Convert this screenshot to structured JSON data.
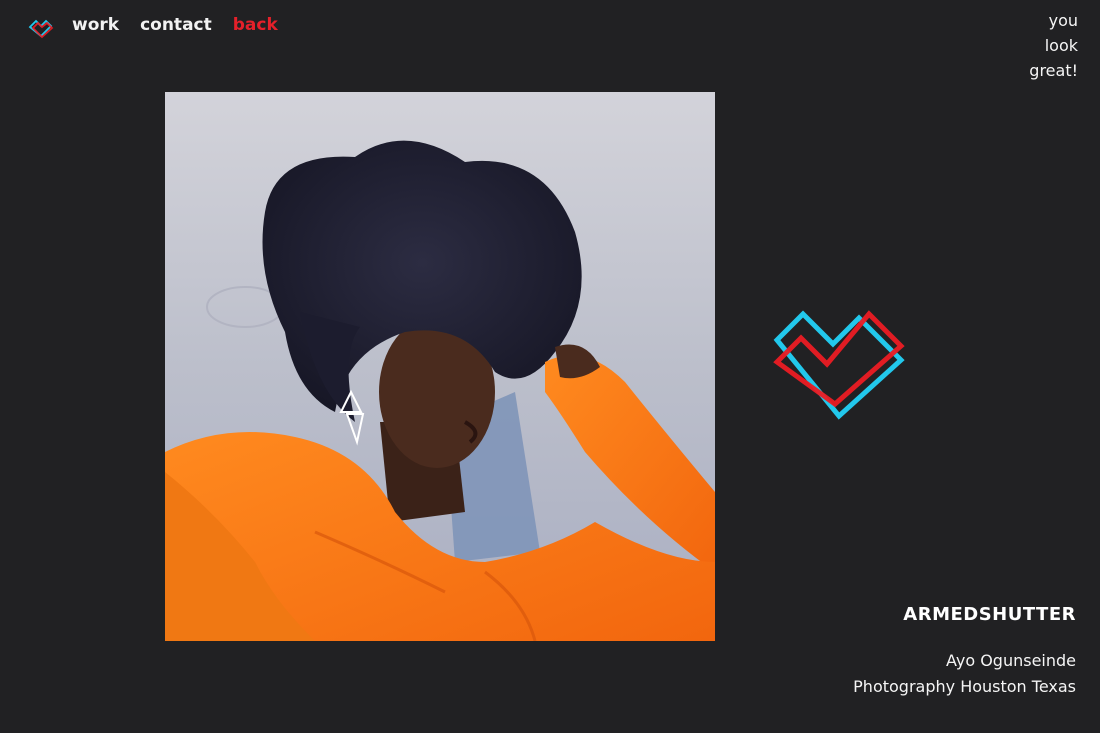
{
  "nav": {
    "logo_icon": "double-heart-logo-icon",
    "items": [
      {
        "label": "work"
      },
      {
        "label": "contact"
      },
      {
        "label": "back"
      }
    ]
  },
  "tagline": [
    "you",
    "look",
    "great!"
  ],
  "photo": {
    "icon": "portrait-photo"
  },
  "logo": {
    "icon": "double-heart-logo-icon",
    "colors": {
      "cyan": "#22c8ec",
      "red": "#ec1c24"
    }
  },
  "brand": {
    "name": "ARMEDSHUTTER",
    "byline_1": "Ayo Ogunseinde",
    "byline_2": "Photography Houston Texas"
  },
  "colors": {
    "background": "#212123",
    "accent": "#e6202a",
    "text": "#ffffff"
  }
}
